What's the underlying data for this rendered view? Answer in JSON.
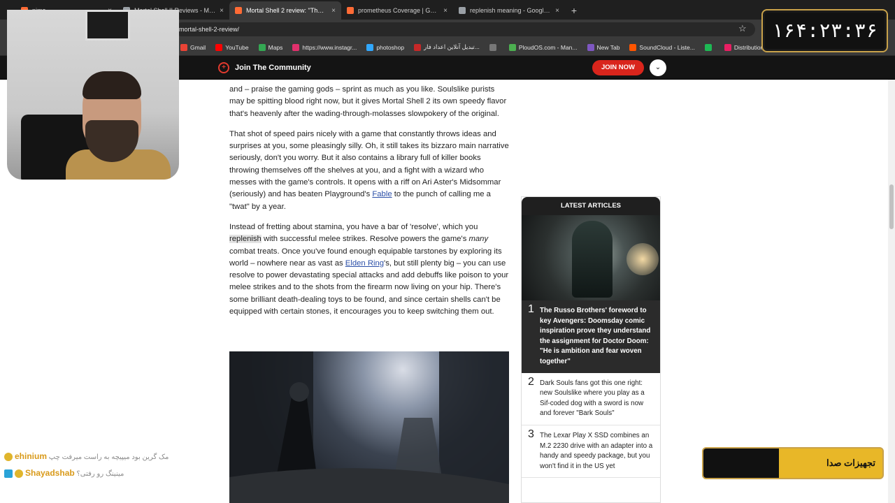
{
  "browser": {
    "tabs": [
      {
        "title": "nimo ...... ...... .....",
        "color": "#ff6b35"
      },
      {
        "title": "Mortal Shell II Reviews - Metacr",
        "color": "#9aa0a6"
      },
      {
        "title": "Mortal Shell 2 review: \"The best",
        "color": "#ff6b35",
        "active": true
      },
      {
        "title": "prometheus Coverage | GamesI",
        "color": "#ff6b35"
      },
      {
        "title": "replenish meaning - Google Se",
        "color": "#9aa0a6"
      }
    ],
    "new_tab": "+",
    "close": "×",
    "url": "mortal-shell-2-review/",
    "star": "☆",
    "bookmarks": [
      {
        "label": "Gmail",
        "color": "#ea4335"
      },
      {
        "label": "YouTube",
        "color": "#ff0000"
      },
      {
        "label": "Maps",
        "color": "#34a853"
      },
      {
        "label": "https://www.instagr...",
        "color": "#e1306c"
      },
      {
        "label": "photoshop",
        "color": "#31a8ff"
      },
      {
        "label": "تبدیل آنلاین اعداد فار...",
        "color": "#c62828"
      },
      {
        "label": "",
        "color": "#777777"
      },
      {
        "label": "PloudOS.com - Man...",
        "color": "#4caf50"
      },
      {
        "label": "New Tab",
        "color": "#7e57c2"
      },
      {
        "label": "SoundCloud - Liste...",
        "color": "#ff5500"
      },
      {
        "label": "",
        "color": "#1db954"
      },
      {
        "label": "Distribution | Route...",
        "color": "#e91e63"
      }
    ]
  },
  "site": {
    "community": "Join The Community",
    "join_now": "JOIN NOW",
    "dropdown": "⌄"
  },
  "article": {
    "p0_top": "and – praise the gaming gods – sprint as much as you like. Soulslike purists may be spitting blood right now, but it gives Mortal Shell 2 its own speedy flavor that's heavenly after the wading-through-molasses slowpokery of the original.",
    "p1_a": "That shot of speed pairs nicely with a game that constantly throws ideas and surprises at you, some pleasingly silly. Oh, it still takes its bizzaro main narrative seriously, don't you worry. But it also contains a library full of killer books throwing themselves off the shelves at you, and a fight with a wizard who messes with the game's controls. It opens with a riff on Ari Aster's Midsommar (seriously) and has beaten Playground's ",
    "p1_link": "Fable",
    "p1_b": " to the punch of calling me a \"twat\" by a year.",
    "p2_a": "Instead of fretting about stamina, you have a bar of 'resolve', which you ",
    "p2_hl": "replenish",
    "p2_b": " with successful melee strikes. Resolve powers the game's ",
    "p2_em": "many",
    "p2_c": " combat treats. Once you've found enough equipable tarstones by exploring its world – nowhere near as vast as ",
    "p2_link": "Elden Ring",
    "p2_d": "'s, but still plenty big – you can use resolve to power devastating special attacks and add debuffs like poison to your melee strikes and to the shots from the firearm now living on your hip. There's some brilliant death-dealing toys to be found, and since certain shells can't be equipped with certain stones, it encourages you to keep switching them out."
  },
  "latest": {
    "heading": "LATEST ARTICLES",
    "items": [
      {
        "num": "1",
        "title": "The Russo Brothers' foreword to key Avengers: Doomsday comic inspiration prove they understand the assignment for Doctor Doom: \"He is ambition and fear woven together\""
      },
      {
        "num": "2",
        "title": "Dark Souls fans got this one right: new Soulslike where you play as a Sif-coded dog with a sword is now and forever \"Bark Souls\""
      },
      {
        "num": "3",
        "title": "The Lexar Play X SSD combines an M.2 2230 drive with an adapter into a handy and speedy package, but you won't find it in the US yet"
      }
    ]
  },
  "overlay": {
    "clock": "۱۶۴:۲۳:۳۶",
    "sponsor": "تجهیزات صدا",
    "chat": [
      {
        "user": "ehinium",
        "msg": "مک گرین بود میپیچه به راست میرفت چپ"
      },
      {
        "user": "Shayadshab",
        "msg": "مینینگ رو رفتی؟"
      }
    ]
  }
}
